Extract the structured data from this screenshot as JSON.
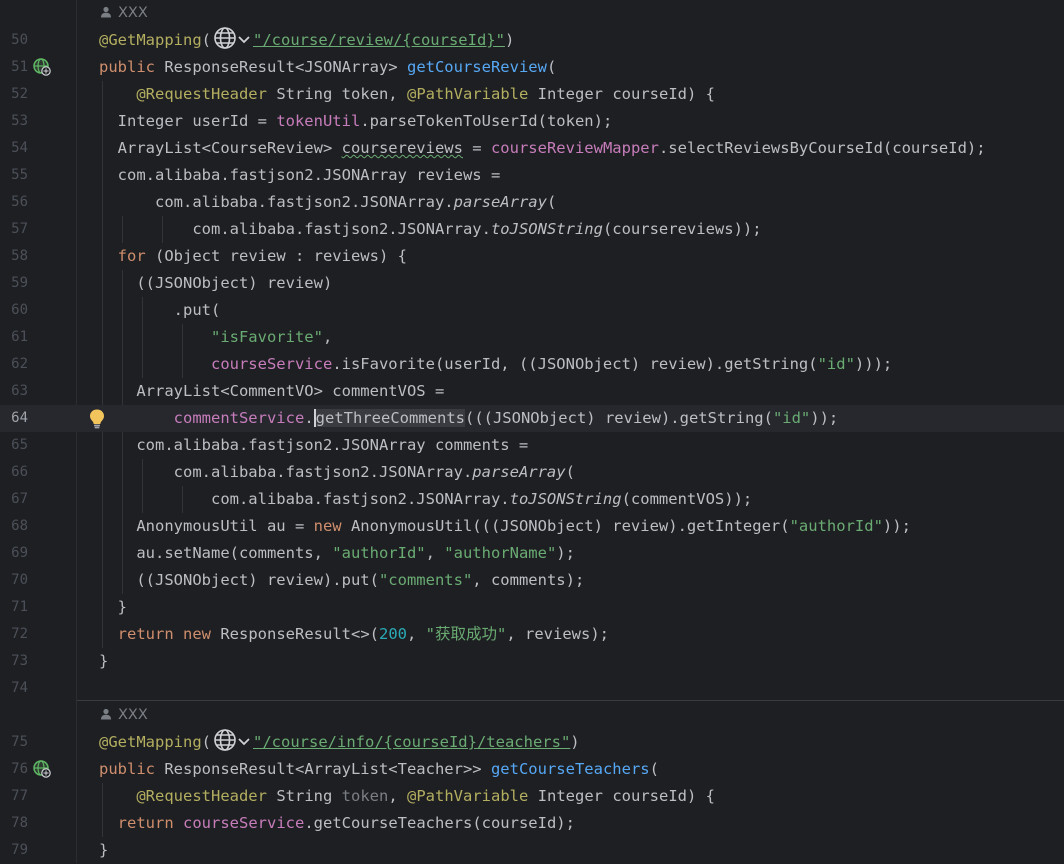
{
  "editor": {
    "language": "Java",
    "current_line": "64",
    "author_hints": [
      {
        "label": "XXX"
      },
      {
        "label": "XXX"
      }
    ],
    "line_numbers": [
      "50",
      "51",
      "52",
      "53",
      "54",
      "55",
      "56",
      "57",
      "58",
      "59",
      "60",
      "61",
      "62",
      "63",
      "64",
      "65",
      "66",
      "67",
      "68",
      "69",
      "70",
      "71",
      "72",
      "73",
      "74",
      "75",
      "76",
      "77",
      "78",
      "79"
    ],
    "code": {
      "l50": {
        "annotation": "@GetMapping",
        "open": "(",
        "path": "\"/course/review/{courseId}\"",
        "close": ")"
      },
      "l51": {
        "kw_public": "public",
        "type": "ResponseResult<JSONArray>",
        "method": "getCourseReview",
        "paren": "("
      },
      "l52": {
        "ann1": "@RequestHeader",
        "mid1": "String token,",
        "ann2": "@PathVariable",
        "mid2": "Integer courseId) {"
      },
      "l53": {
        "pre": "Integer userId = ",
        "field": "tokenUtil",
        "post": ".parseTokenToUserId(token);"
      },
      "l54": {
        "pre": "ArrayList<CourseReview> ",
        "var": "coursereviews",
        "mid": " = ",
        "field": "courseReviewMapper",
        "post": ".selectReviewsByCourseId(courseId);"
      },
      "l55": {
        "text": "com.alibaba.fastjson2.JSONArray reviews ="
      },
      "l56": {
        "pre": "com.alibaba.fastjson2.JSONArray.",
        "method": "parseArray",
        "post": "("
      },
      "l57": {
        "pre": "com.alibaba.fastjson2.JSONArray.",
        "method": "toJSONString",
        "post": "(coursereviews));"
      },
      "l58": {
        "kw_for": "for",
        "post": " (Object review : reviews) {"
      },
      "l59": {
        "text": "((JSONObject) review)"
      },
      "l60": {
        "text": ".put("
      },
      "l61": {
        "str": "\"isFavorite\"",
        "post": ","
      },
      "l62": {
        "field": "courseService",
        "mid": ".isFavorite(userId, ((JSONObject) review).getString(",
        "str": "\"id\"",
        "post": ")));"
      },
      "l63": {
        "text": "ArrayList<CommentVO> commentVOS ="
      },
      "l64": {
        "field": "commentService",
        "dot": ".",
        "caret_char": "g",
        "method_rest": "etThreeComments",
        "mid": "(((JSONObject) review).getString(",
        "str": "\"id\"",
        "post": "));"
      },
      "l65": {
        "text": "com.alibaba.fastjson2.JSONArray comments ="
      },
      "l66": {
        "pre": "com.alibaba.fastjson2.JSONArray.",
        "method": "parseArray",
        "post": "("
      },
      "l67": {
        "pre": "com.alibaba.fastjson2.JSONArray.",
        "method": "toJSONString",
        "post": "(commentVOS));"
      },
      "l68": {
        "pre": "AnonymousUtil au = ",
        "kw_new": "new",
        "mid": " AnonymousUtil(((JSONObject) review).getInteger(",
        "str": "\"authorId\"",
        "post": "));"
      },
      "l69": {
        "pre": "au.setName(comments, ",
        "str1": "\"authorId\"",
        "mid": ", ",
        "str2": "\"authorName\"",
        "post": ");"
      },
      "l70": {
        "pre": "((JSONObject) review).put(",
        "str": "\"comments\"",
        "post": ", comments);"
      },
      "l71": {
        "text": "}"
      },
      "l72": {
        "kw_return": "return",
        "kw_new": "new",
        "mid": " ResponseResult<>(",
        "num": "200",
        "sep": ", ",
        "str": "\"获取成功\"",
        "post": ", reviews);"
      },
      "l73": {
        "text": "}"
      },
      "l75": {
        "annotation": "@GetMapping",
        "open": "(",
        "path": "\"/course/info/{courseId}/teachers\"",
        "close": ")"
      },
      "l76": {
        "kw_public": "public",
        "type": "ResponseResult<ArrayList<Teacher>>",
        "method": "getCourseTeachers",
        "paren": "("
      },
      "l77": {
        "ann1": "@RequestHeader",
        "mid1": "String ",
        "unused": "token",
        "comma": ",",
        "ann2": "@PathVariable",
        "mid2": "Integer courseId) {"
      },
      "l78": {
        "kw_return": "return",
        "field": "courseService",
        "post": ".getCourseTeachers(courseId);"
      },
      "l79": {
        "text": "}"
      }
    },
    "icons": {
      "endpoint_gutter_icon": "run-endpoint-globe-icon",
      "intention_icon": "lightbulb-icon",
      "endpoint_inlay_icon": "globe-icon",
      "author_icon": "person-icon"
    },
    "colors": {
      "background": "#1e1f22",
      "current_line": "#26282e",
      "keyword": "#cf8e6d",
      "annotation": "#b3ae60",
      "string": "#6aab73",
      "method_decl": "#56a8f5",
      "field": "#c77dbb",
      "number": "#2aacb8"
    }
  }
}
